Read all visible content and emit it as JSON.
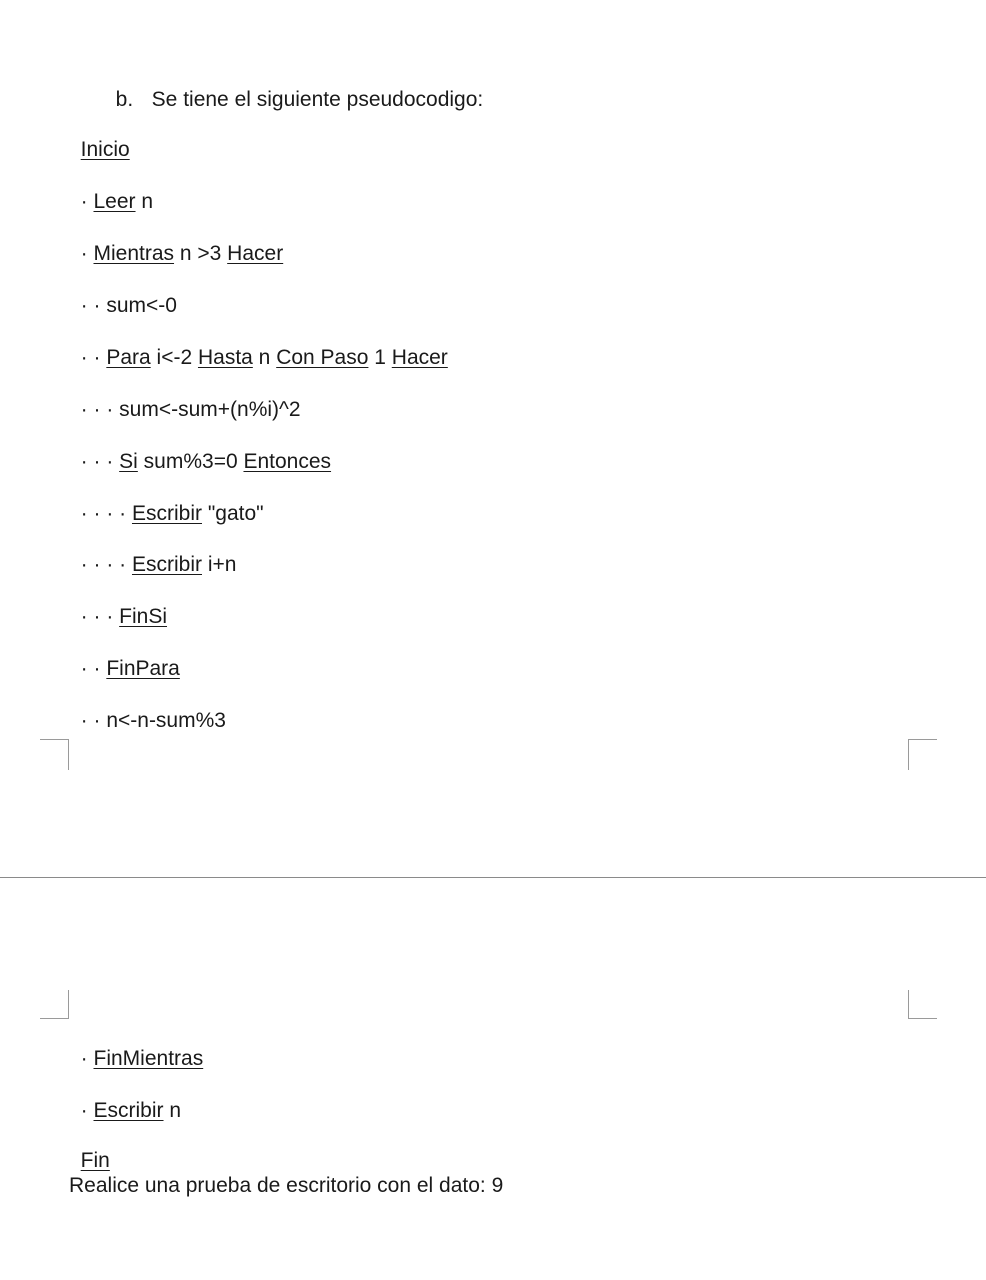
{
  "heading": {
    "marker": "b.",
    "text": "Se tiene el siguiente pseudocodigo:"
  },
  "code": {
    "inicio": "Inicio",
    "leer_dots": "· ",
    "leer_kw": "Leer",
    "leer_rest": " n",
    "mientras_dots": "· ",
    "mientras_kw": "Mientras",
    "mientras_mid": " n >3 ",
    "mientras_kw2": "Hacer",
    "sum0_text": "· · sum<-0",
    "para_dots": "· · ",
    "para_kw": "Para",
    "para_mid1": " i<-2 ",
    "para_kw2": "Hasta",
    "para_mid2": " n ",
    "para_kw3": "Con Paso",
    "para_mid3": " 1 ",
    "para_kw4": "Hacer",
    "sumacc_text": "· · · sum<-sum+(n%i)^2",
    "si_dots": "· · · ",
    "si_kw": "Si",
    "si_mid": " sum%3=0 ",
    "si_kw2": "Entonces",
    "esc1_dots": "· · · · ",
    "esc1_kw": "Escribir",
    "esc1_rest": " \"gato\"",
    "esc2_dots": "· · · · ",
    "esc2_kw": "Escribir",
    "esc2_rest": " i+n",
    "finsi_dots": "· · · ",
    "finsi_kw": "FinSi",
    "finpara_dots": "· · ",
    "finpara_kw": "FinPara",
    "nupdate_text": "· · n<-n-sum%3",
    "finmientras_dots": "· ",
    "finmientras_kw": "FinMientras",
    "escn_dots": "· ",
    "escn_kw": "Escribir",
    "escn_rest": " n",
    "fin": "Fin"
  },
  "instruction": "Realice una prueba de escritorio con el dato: 9"
}
